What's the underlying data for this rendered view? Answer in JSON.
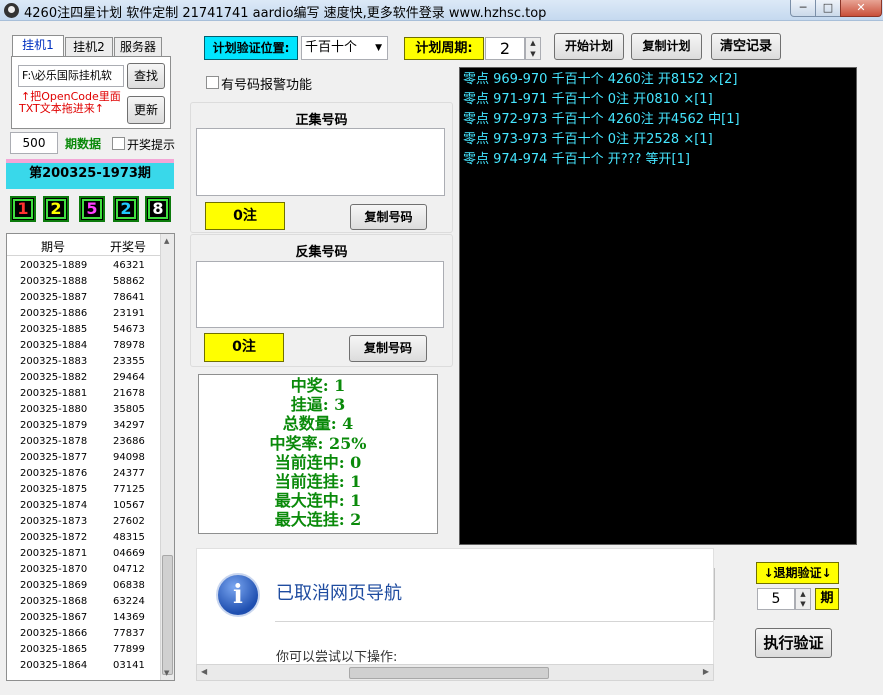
{
  "window": {
    "title": "4260注四星计划 软件定制 21741741 aardio编写 速度快,更多软件登录 www.hzhsc.top",
    "minimize": "─",
    "maximize": "□",
    "close": "✕"
  },
  "tabs": [
    "挂机1",
    "挂机2",
    "服务器"
  ],
  "hang": {
    "path_value": "F:\\必乐国际挂机软",
    "find_button": "查找",
    "update_button": "更新",
    "hint_line1": "↑把OpenCode里面",
    "hint_line2": "TXT文本拖进来↑"
  },
  "period_count": {
    "value": "500",
    "label": "期数据",
    "award_tip": "开奖提示"
  },
  "current_period": "第200325-1973期",
  "balls": [
    {
      "digit": "1",
      "color": "#ff3030"
    },
    {
      "digit": "2",
      "color": "#ffff00"
    },
    {
      "digit": "5",
      "color": "#ff40ff"
    },
    {
      "digit": "2",
      "color": "#20c8ff"
    },
    {
      "digit": "8",
      "color": "#ffffff"
    }
  ],
  "history": {
    "col_period": "期号",
    "col_number": "开奖号",
    "rows": [
      [
        "200325-1889",
        "46321"
      ],
      [
        "200325-1888",
        "58862"
      ],
      [
        "200325-1887",
        "78641"
      ],
      [
        "200325-1886",
        "23191"
      ],
      [
        "200325-1885",
        "54673"
      ],
      [
        "200325-1884",
        "78978"
      ],
      [
        "200325-1883",
        "23355"
      ],
      [
        "200325-1882",
        "29464"
      ],
      [
        "200325-1881",
        "21678"
      ],
      [
        "200325-1880",
        "35805"
      ],
      [
        "200325-1879",
        "34297"
      ],
      [
        "200325-1878",
        "23686"
      ],
      [
        "200325-1877",
        "94098"
      ],
      [
        "200325-1876",
        "24377"
      ],
      [
        "200325-1875",
        "77125"
      ],
      [
        "200325-1874",
        "10567"
      ],
      [
        "200325-1873",
        "27602"
      ],
      [
        "200325-1872",
        "48315"
      ],
      [
        "200325-1871",
        "04669"
      ],
      [
        "200325-1870",
        "04712"
      ],
      [
        "200325-1869",
        "06838"
      ],
      [
        "200325-1868",
        "63224"
      ],
      [
        "200325-1867",
        "14369"
      ],
      [
        "200325-1866",
        "77837"
      ],
      [
        "200325-1865",
        "77899"
      ],
      [
        "200325-1864",
        "03141"
      ]
    ]
  },
  "plan": {
    "verify_position_label": "计划验证位置:",
    "verify_position_value": "千百十个",
    "cycle_label": "计划周期:",
    "cycle_value": "2",
    "start_button": "开始计划",
    "copy_button": "复制计划",
    "clear_button": "清空记录",
    "alarm_label": "有号码报警功能"
  },
  "positive_set": {
    "title": "正集号码",
    "count": "0注",
    "copy_button": "复制号码"
  },
  "negative_set": {
    "title": "反集号码",
    "count": "0注",
    "copy_button": "复制号码"
  },
  "stats": [
    "中奖: 1",
    "挂逼: 3",
    "总数量: 4",
    "中奖率: 25%",
    "当前连中: 0",
    "当前连挂: 1",
    "最大连中: 1",
    "最大连挂: 2"
  ],
  "console_lines": [
    "零点 969-970 千百十个 4260注 开8152 ×[2]",
    "零点 971-971 千百十个 0注 开0810 ×[1]",
    "零点 972-973 千百十个 4260注 开4562 中[1]",
    "零点 973-973 千百十个 0注 开2528 ×[1]",
    "零点 974-974 千百十个 开??? 等开[1]"
  ],
  "browser": {
    "headline": "已取消网页导航",
    "sub": "你可以尝试以下操作:"
  },
  "back_verify": {
    "label": "↓退期验证↓",
    "value": "5",
    "unit": "期",
    "run_button": "执行验证"
  }
}
